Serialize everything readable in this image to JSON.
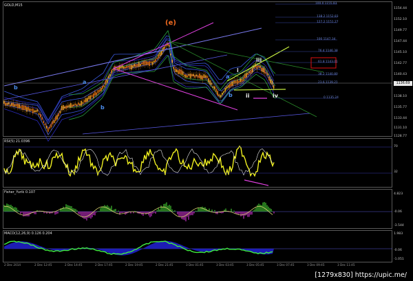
{
  "symbol_label": "GOLD,M15",
  "price_axis": [
    "1154.44",
    "1152.10",
    "1149.77",
    "1147.44",
    "1145.10",
    "1142.77",
    "1140.43",
    "1138.10",
    "1135.77",
    "1133.44",
    "1131.10",
    "1128.77"
  ],
  "current_price": "1136.69",
  "waves": {
    "e": "(e)",
    "a1": "a",
    "b1": "b",
    "b2": "b",
    "b3": "b",
    "a2": "a",
    "i": "i",
    "ii": "ii",
    "iii": "iii",
    "iv": "iv"
  },
  "fib_levels": [
    "100.0 1155.83",
    "138.2 1152.83",
    "127.2 1151.27",
    "100 1147.34",
    "76.4 1146.38",
    "61.8 1143.01",
    "38.2 1140.80",
    "23.6 1139.21",
    "0 1135.24"
  ],
  "rsi": {
    "label": "RSI(5) 21.0396",
    "axis": [
      "70",
      "32"
    ]
  },
  "fisher": {
    "label": "Fisher_Yurik 0.107",
    "axis": [
      "4.823",
      "-0.06",
      "-3.544"
    ]
  },
  "macd": {
    "label": "MACD(12,26,9) 0.126 0.204",
    "axis": [
      "1.983",
      "-0.06",
      "-1.051"
    ]
  },
  "time_labels": [
    "2 Dec 2014",
    "2 Dec 12:45",
    "2 Dec 14:45",
    "2 Dec 17:45",
    "2 Dec 19:45",
    "2 Dec 21:45",
    "3 Dec 01:45",
    "3 Dec 03:45",
    "3 Dec 05:45",
    "3 Dec 07:45",
    "3 Dec 09:45",
    "3 Dec 11:45"
  ],
  "credit": "[1279x830] https://upic.me/",
  "colors": {
    "bull": "#f0a020",
    "bear": "#e07010",
    "magenta": "#e040e0",
    "lime": "#c8f040",
    "red": "#e01010",
    "blue": "#4a4ad8",
    "green": "#2aa040",
    "yellow": "#f0f020",
    "orange_label": "#f06a20"
  }
}
